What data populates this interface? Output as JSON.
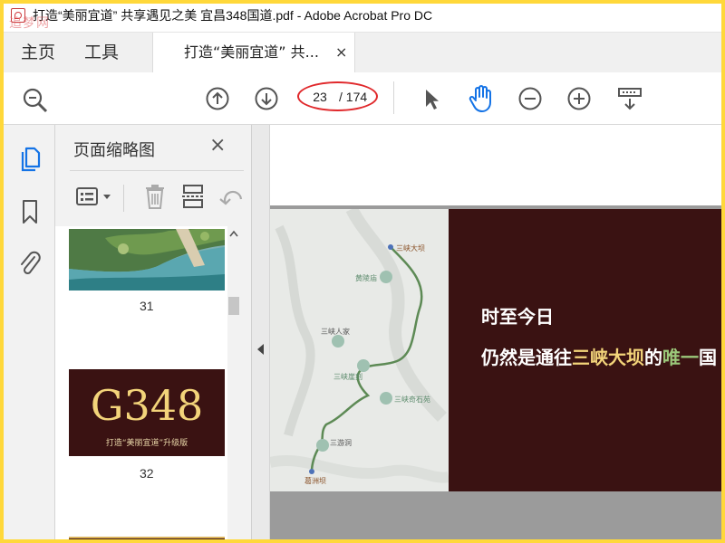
{
  "window": {
    "title": "打造“美丽宜道” 共享遇见之美 宜昌348国道.pdf - Adobe Acrobat Pro DC",
    "watermark": "追梦网"
  },
  "tabs": {
    "home": "主页",
    "tools": "工具",
    "document": "打造“美丽宜道” 共...",
    "close": "×"
  },
  "toolbar": {
    "current_page": "23",
    "total_pages": "/ 174",
    "icons": [
      "search-zoom-icon",
      "page-up-icon",
      "page-down-icon",
      "select-arrow-icon",
      "hand-tool-icon",
      "zoom-out-icon",
      "zoom-in-icon",
      "display-mode-icon"
    ]
  },
  "thumbnails_panel": {
    "title": "页面缩略图",
    "close": "×",
    "pages": [
      {
        "number": "31"
      },
      {
        "number": "32",
        "heading": "G348",
        "caption": "打造“美丽宜道”升级版"
      }
    ]
  },
  "slide": {
    "line1": "时至今日",
    "line2_before": "仍然是通往",
    "line2_highlight": "三峡大坝",
    "line2_mid": "的",
    "line2_highlight2": "唯一",
    "line2_after": "国",
    "map_labels": {
      "dam": "三峡大坝",
      "huangling": "黄陵庙",
      "renjia": "三峡人家",
      "yaji": "三峡崖刻",
      "qishi": "三峡奇石苑",
      "sanyou": "三游洞",
      "gezhou": "葛洲坝"
    }
  },
  "colors": {
    "accent": "#1473e6",
    "highlight_ring": "#e0282b",
    "slide_bg": "#3a1212",
    "thumb_title_gold": "#f3d47a",
    "frame": "#ffd83a"
  }
}
